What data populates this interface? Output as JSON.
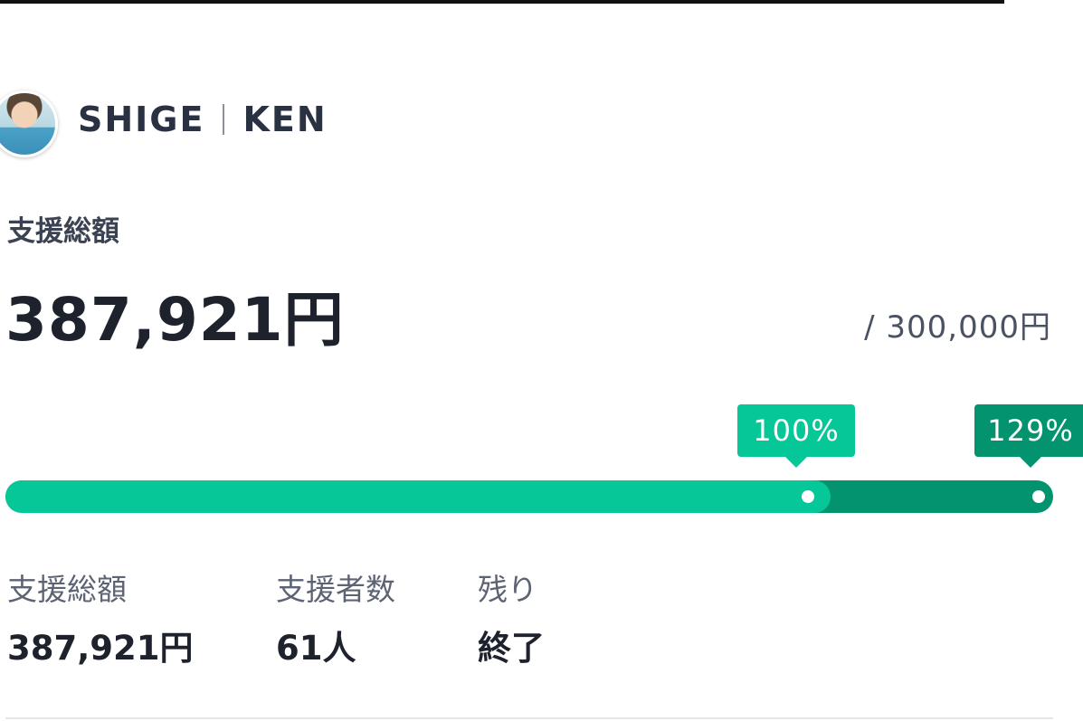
{
  "author": {
    "first": "SHIGE",
    "last": "KEN"
  },
  "funding": {
    "total_label": "支援総額",
    "total_amount": "387,921円",
    "goal_amount": "/ 300,000円",
    "goal_tag": "100%",
    "current_tag": "129%",
    "progress_ratio": 1.29
  },
  "stats": [
    {
      "label": "支援総額",
      "value": "387,921円"
    },
    {
      "label": "支援者数",
      "value": "61人"
    },
    {
      "label": "残り",
      "value": "終了"
    }
  ],
  "colors": {
    "bar_fill": "#05c797",
    "bar_over": "#03946f",
    "text_dark": "#1d222c"
  },
  "icons": {
    "avatar": "user-avatar-photo"
  }
}
